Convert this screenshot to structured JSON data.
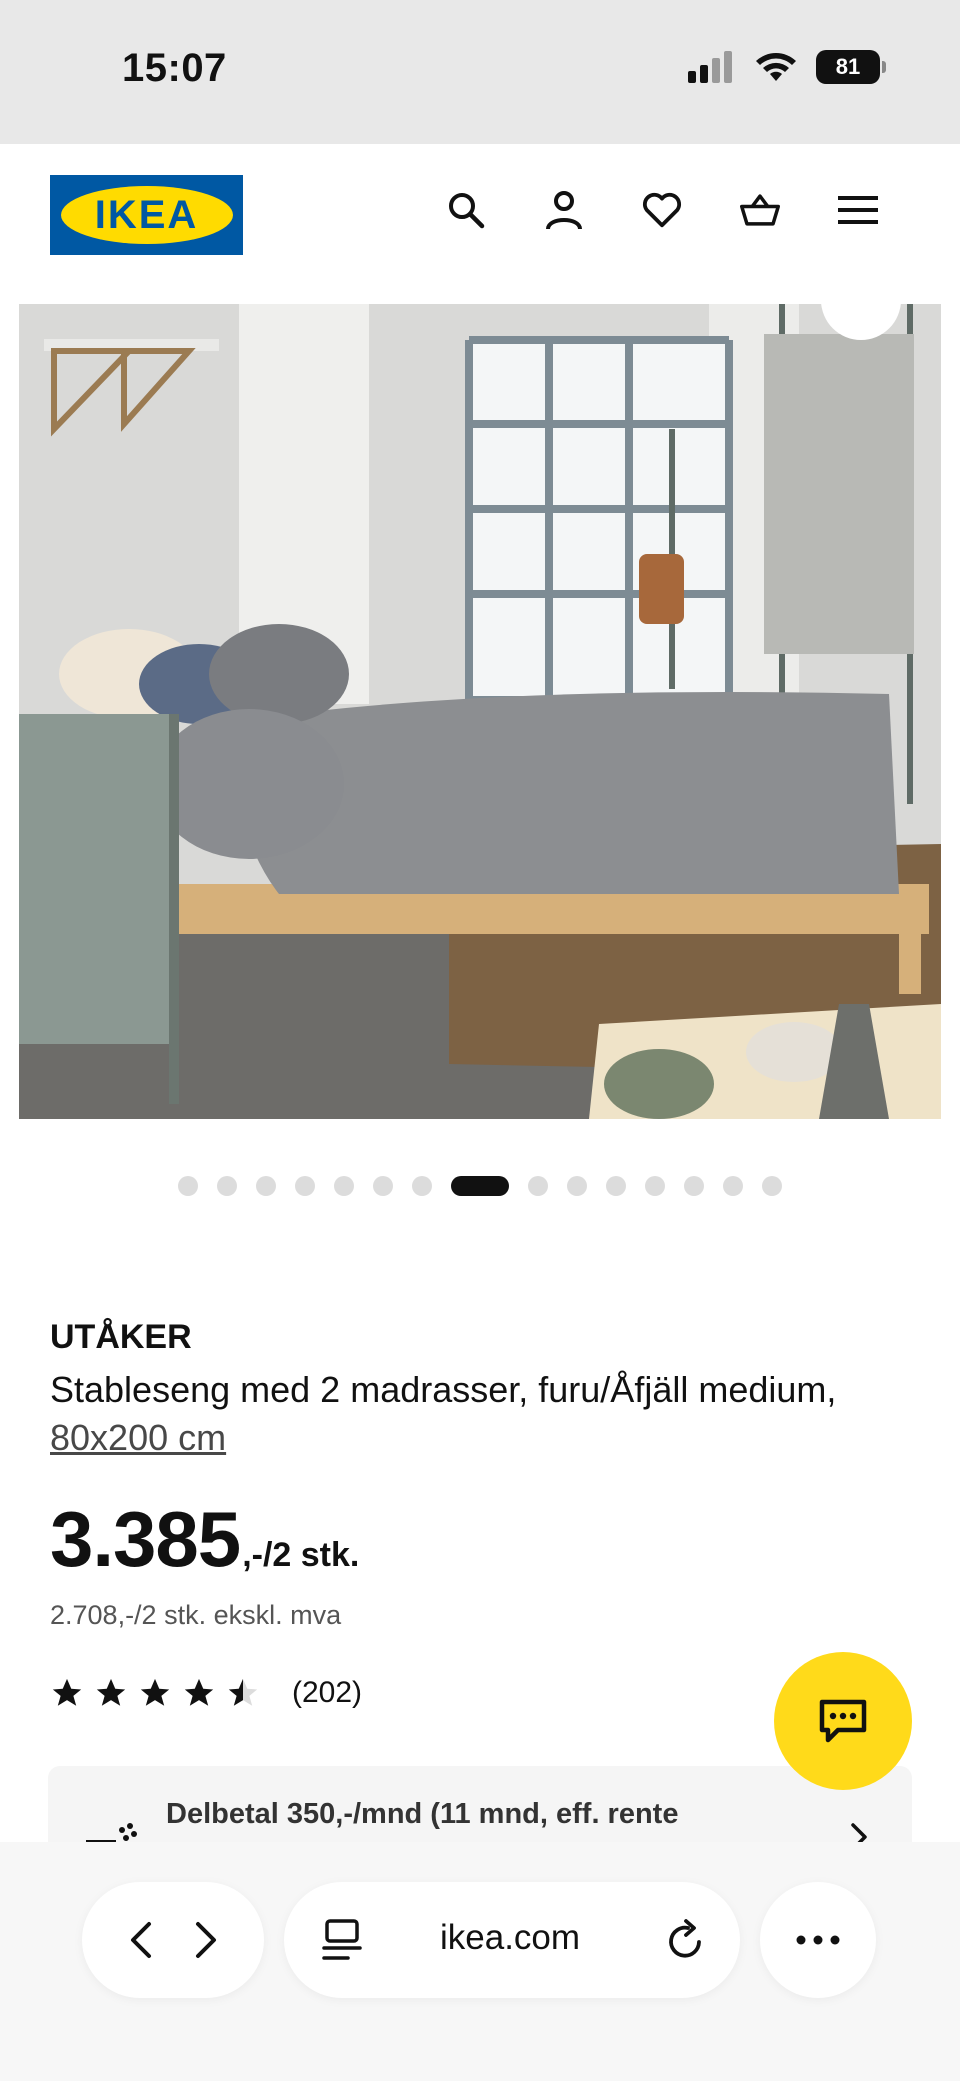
{
  "status_bar": {
    "time": "15:07",
    "battery": "81",
    "icons": [
      "cellular-signal-icon",
      "wifi-icon",
      "battery-icon"
    ]
  },
  "header": {
    "logo_text": "IKEA",
    "icons": [
      "search-icon",
      "account-icon",
      "wishlist-heart-icon",
      "shopping-basket-icon",
      "menu-icon"
    ]
  },
  "carousel": {
    "total": 15,
    "active_index": 7
  },
  "product": {
    "brand": "UTÅKER",
    "description": "Stableseng med 2 madrasser, furu/Åfjäll medium, ",
    "size_link": "80x200 cm",
    "price": "3.385",
    "price_suffix": ",-/2 stk.",
    "price_ex_vat": "2.708,-/2 stk. ekskl. mva",
    "rating": 4.5,
    "review_count": "(202)"
  },
  "finance": {
    "text": "Delbetal 350,-/mnd (11 mnd, eff. rente"
  },
  "browser": {
    "url": "ikea.com"
  },
  "colors": {
    "ikea_blue": "#0058a3",
    "ikea_yellow": "#ffdb00",
    "chat_yellow": "#ffda1a"
  }
}
